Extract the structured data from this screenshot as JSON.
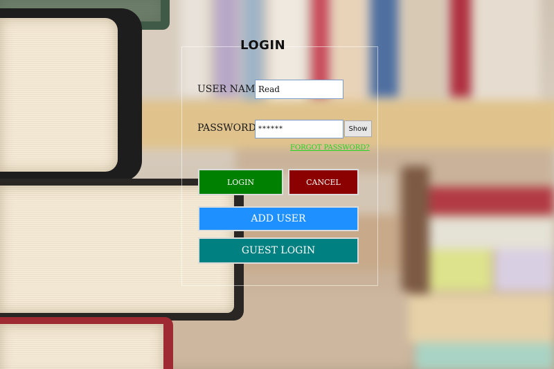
{
  "login": {
    "title": "LOGIN",
    "username_label": "USER NAME",
    "username_value": "Read",
    "password_label": "PASSWORD",
    "password_value": "******",
    "show_button": "Show",
    "forgot_link": "FORGOT PASSWORD?",
    "login_button": "LOGIN",
    "cancel_button": "CANCEL",
    "add_user_button": "ADD USER",
    "guest_login_button": "GUEST LOGIN"
  },
  "colors": {
    "login_button": "#008000",
    "cancel_button": "#8b0000",
    "add_user_button": "#1e90ff",
    "guest_login_button": "#008080",
    "forgot_link": "#22d422"
  }
}
